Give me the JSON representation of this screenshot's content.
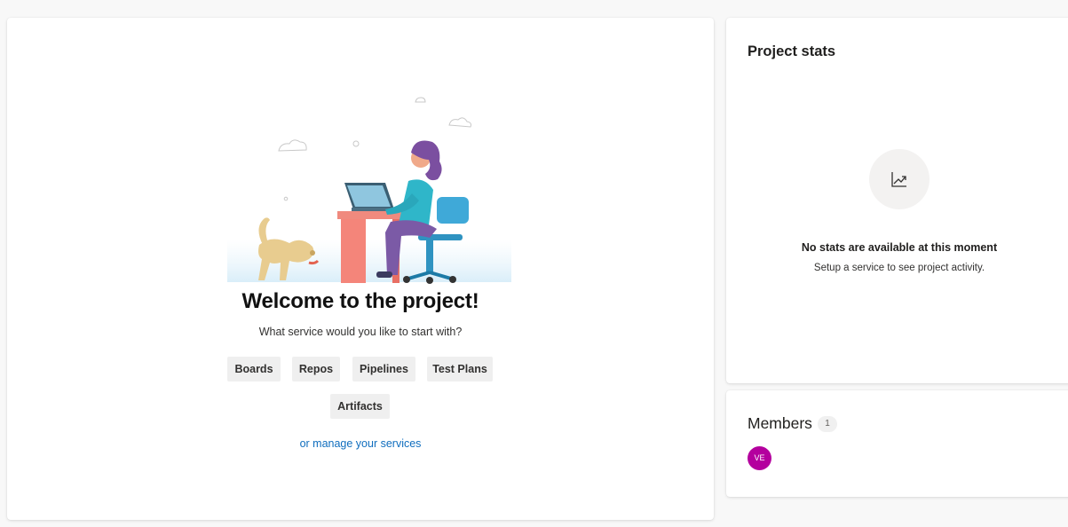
{
  "welcome": {
    "title": "Welcome to the project!",
    "subtitle": "What service would you like to start with?",
    "services": [
      "Boards",
      "Repos",
      "Pipelines",
      "Test Plans",
      "Artifacts"
    ],
    "manage_link": "or manage your services"
  },
  "stats": {
    "title": "Project stats",
    "icon": "trending-chart-icon",
    "empty_title": "No stats are available at this moment",
    "empty_subtitle": "Setup a service to see project activity."
  },
  "members": {
    "title": "Members",
    "count": "1",
    "avatars": [
      {
        "initials": "VE",
        "color": "#b4009e"
      }
    ]
  },
  "colors": {
    "link": "#106ebe",
    "page_background": "#f8f8f8",
    "button_background": "#efefef"
  }
}
